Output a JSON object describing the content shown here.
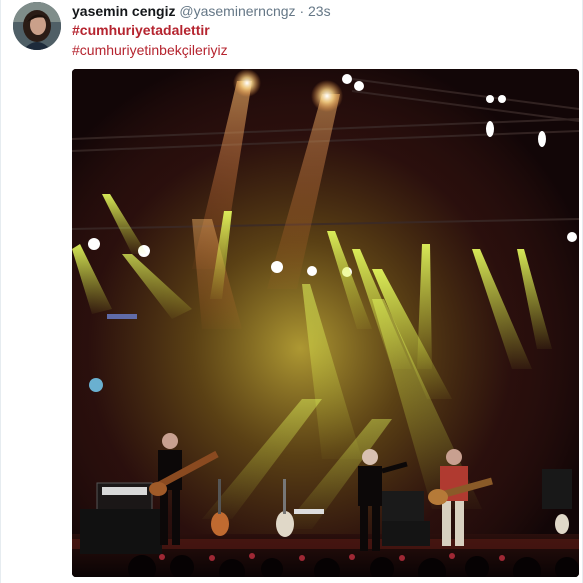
{
  "tweet": {
    "author_name": "yasemin cengiz",
    "author_handle": "@yaseminerncngz",
    "separator": "·",
    "time": "23s",
    "hashtags": [
      "#cumhuriyetadalettir",
      "#cumhuriyetinbekçileriyiz"
    ]
  },
  "media": {
    "icon": "concert-photo"
  },
  "colors": {
    "hashtag": "#b5242f",
    "name": "#14171a",
    "muted": "#657786"
  }
}
